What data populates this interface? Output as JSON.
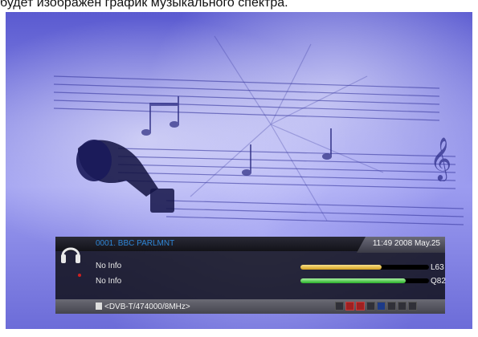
{
  "caption": "будет изображен график музыкального спектра.",
  "osd": {
    "channel": "0001. BBC PARLMNT",
    "datetime": "11:49 2008 May.25",
    "info_line_1": "No Info",
    "info_line_2": "No Info",
    "signal_level": {
      "label": "L63",
      "fraction": 0.63
    },
    "signal_quality": {
      "label": "Q82",
      "fraction": 0.82
    },
    "transponder": "<DVB-T/474000/8MHz>"
  },
  "status_icons": [
    "subtitle-icon",
    "mute-icon",
    "scramble-icon",
    "teletext-icon",
    "signal-icon",
    "lock-icon",
    "favorite-icon",
    "epg-icon"
  ],
  "colors": {
    "channel_text": "#2e86d6",
    "level_bar": "#d4a020",
    "quality_bar": "#28b028"
  }
}
